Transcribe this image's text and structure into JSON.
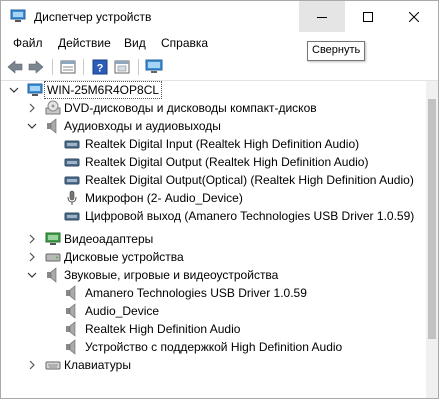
{
  "window": {
    "title": "Диспетчер устройств",
    "tooltip": "Свернуть"
  },
  "menu": [
    "Файл",
    "Действие",
    "Вид",
    "Справка"
  ],
  "toolbar": [
    "back-icon",
    "forward-icon",
    "properties-icon",
    "help-icon",
    "show-hidden-icon",
    "monitor-icon"
  ],
  "tree": {
    "root": "WIN-25M6R4OP8CL",
    "items": [
      {
        "label": "DVD-дисководы и дисководы компакт-дисков",
        "expanded": false,
        "icon": "dvd-icon"
      },
      {
        "label": "Аудиовходы и аудиовыходы",
        "expanded": true,
        "icon": "speaker-icon",
        "children": [
          {
            "label": "Realtek Digital Input (Realtek High Definition Audio)",
            "icon": "audio-port-icon"
          },
          {
            "label": "Realtek Digital Output (Realtek High Definition Audio)",
            "icon": "audio-port-icon"
          },
          {
            "label": "Realtek Digital Output(Optical) (Realtek High Definition Audio)",
            "icon": "audio-port-icon"
          },
          {
            "label": "Микрофон (2- Audio_Device)",
            "icon": "microphone-icon"
          },
          {
            "label": "Цифровой выход (Amanero Technologies USB Driver 1.0.59)",
            "icon": "audio-port-icon"
          }
        ]
      },
      {
        "label": "Видеоадаптеры",
        "expanded": false,
        "icon": "display-adapter-icon"
      },
      {
        "label": "Дисковые устройства",
        "expanded": false,
        "icon": "disk-icon"
      },
      {
        "label": "Звуковые, игровые и видеоустройства",
        "expanded": true,
        "icon": "speaker-icon",
        "children": [
          {
            "label": "Amanero Technologies USB Driver 1.0.59",
            "icon": "speaker-icon"
          },
          {
            "label": "Audio_Device",
            "icon": "speaker-icon"
          },
          {
            "label": "Realtek High Definition Audio",
            "icon": "speaker-icon"
          },
          {
            "label": "Устройство с поддержкой High Definition Audio",
            "icon": "speaker-icon"
          }
        ]
      },
      {
        "label": "Клавиатуры",
        "expanded": false,
        "icon": "keyboard-icon"
      }
    ]
  }
}
